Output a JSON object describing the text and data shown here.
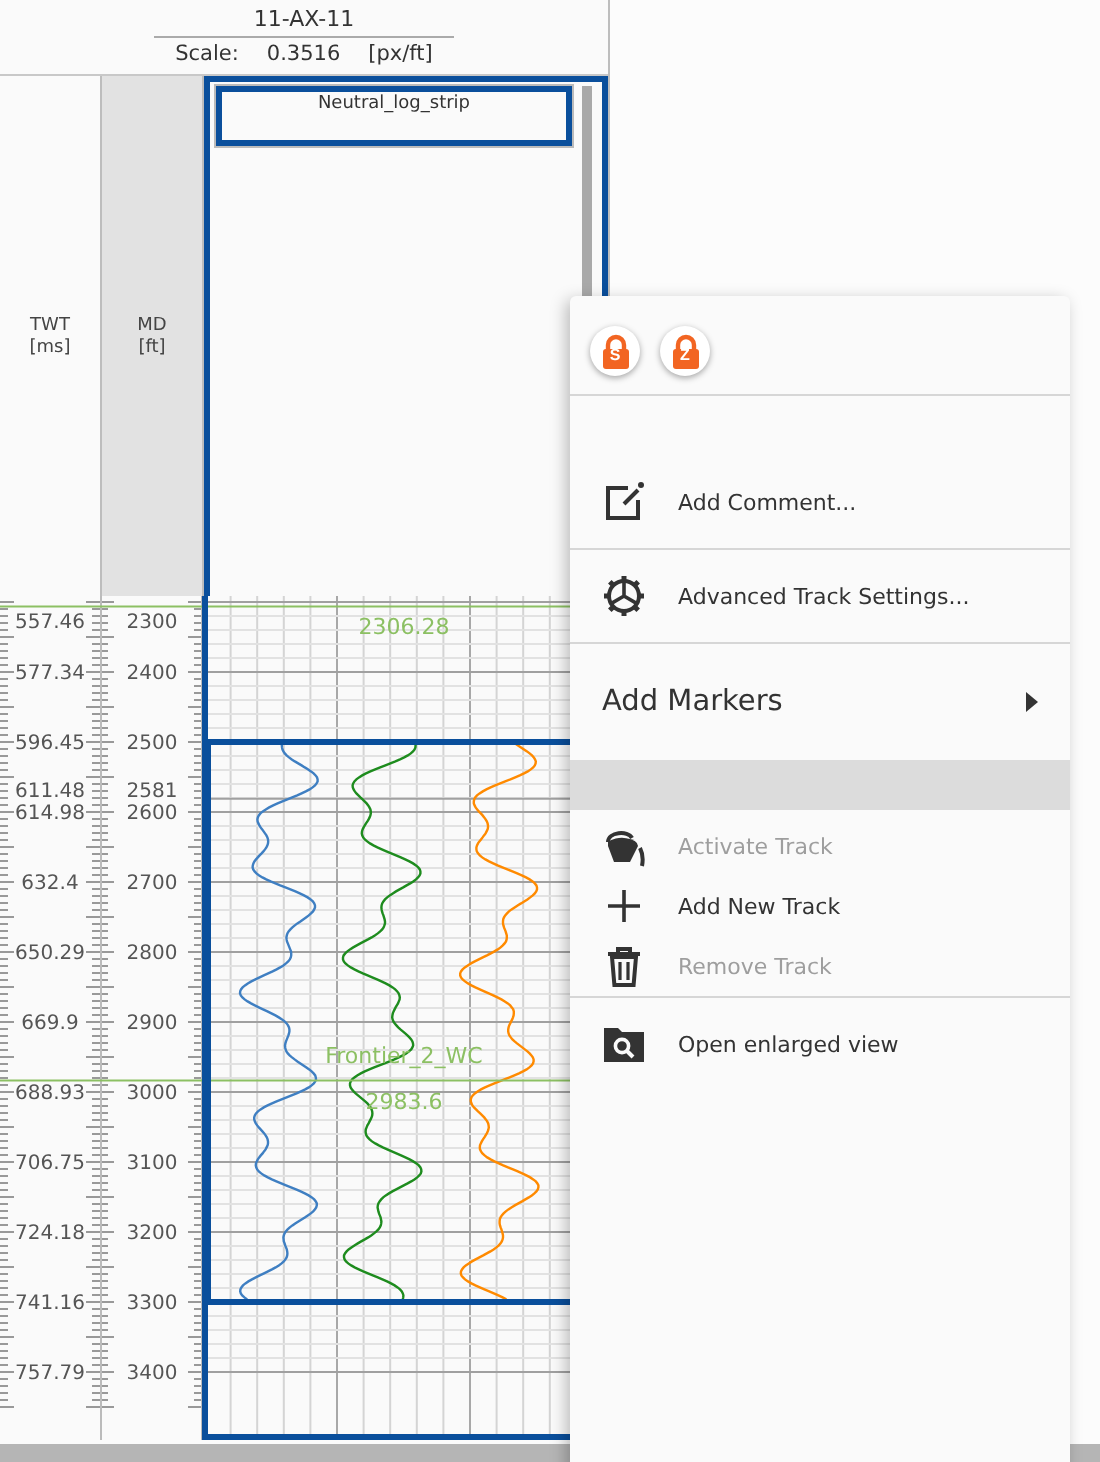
{
  "well": {
    "name": "11-AX-11",
    "scale_label": "Scale:",
    "scale_value": "0.3516",
    "scale_unit": "[px/ft]"
  },
  "columns": [
    {
      "title": "TWT",
      "unit": "[ms]"
    },
    {
      "title": "MD",
      "unit": "[ft]"
    }
  ],
  "track": {
    "title": "Neutral_log_strip",
    "selected": true
  },
  "depth_ticks": [
    {
      "twt": "557.46",
      "md": "2300"
    },
    {
      "twt": "577.34",
      "md": "2400"
    },
    {
      "twt": "596.45",
      "md": "2500"
    },
    {
      "twt": "611.48",
      "md": "2581"
    },
    {
      "twt": "614.98",
      "md": "2600"
    },
    {
      "twt": "632.4",
      "md": "2700"
    },
    {
      "twt": "650.29",
      "md": "2800"
    },
    {
      "twt": "669.9",
      "md": "2900"
    },
    {
      "twt": "688.93",
      "md": "3000"
    },
    {
      "twt": "706.75",
      "md": "3100"
    },
    {
      "twt": "724.18",
      "md": "3200"
    },
    {
      "twt": "741.16",
      "md": "3300"
    },
    {
      "twt": "757.79",
      "md": "3400"
    }
  ],
  "markers": [
    {
      "label": "2306.28"
    },
    {
      "name": "Frontier_2_WC",
      "label": "2983.6"
    }
  ],
  "curves": [
    {
      "color": "#3f7fc2"
    },
    {
      "color": "#1e8c1e"
    },
    {
      "color": "#ff8a00"
    }
  ],
  "menu": {
    "locks": [
      {
        "letter": "S"
      },
      {
        "letter": "Z"
      }
    ],
    "items": [
      {
        "kind": "divider"
      },
      {
        "kind": "spacer"
      },
      {
        "kind": "item",
        "label": "Add Comment...",
        "disabled": false
      },
      {
        "kind": "divider"
      },
      {
        "kind": "item",
        "label": "Advanced Track Settings...",
        "disabled": false
      },
      {
        "kind": "divider"
      },
      {
        "kind": "submenu",
        "label": "Add Markers"
      },
      {
        "kind": "band"
      },
      {
        "kind": "item",
        "label": "Activate Track",
        "disabled": true
      },
      {
        "kind": "item",
        "label": "Add New Track",
        "disabled": false
      },
      {
        "kind": "item",
        "label": "Remove Track",
        "disabled": true
      },
      {
        "kind": "divider"
      },
      {
        "kind": "item",
        "label": "Open enlarged view",
        "disabled": false
      }
    ]
  }
}
